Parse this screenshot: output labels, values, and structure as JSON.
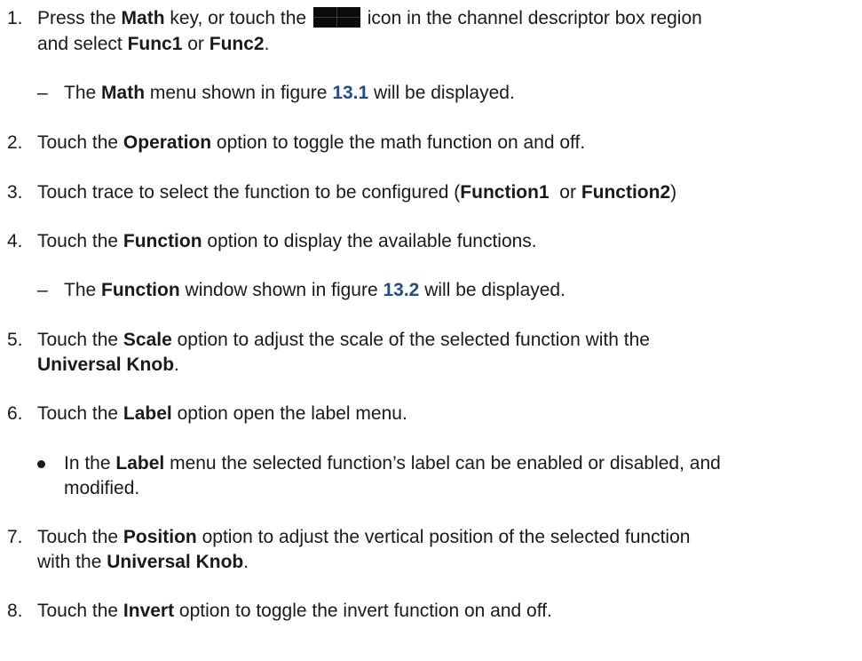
{
  "steps": [
    {
      "number": "1.",
      "line1": [
        "Press the ",
        "Math",
        " key, or touch the ",
        " icon in the channel descriptor box region"
      ],
      "line2": [
        "and select ",
        "Func1",
        " or ",
        "Func2",
        "."
      ],
      "sub": [
        "The ",
        "Math",
        " menu shown in figure ",
        "13.1",
        " will be displayed."
      ]
    },
    {
      "number": "2.",
      "line1": [
        "Touch the ",
        "Operation",
        " option to toggle the math function on and off."
      ]
    },
    {
      "number": "3.",
      "line1": [
        "Touch trace to select the function to be configured (",
        "Function1",
        "  or ",
        "Function2",
        ")"
      ]
    },
    {
      "number": "4.",
      "line1": [
        "Touch the ",
        "Function",
        " option to display the available functions."
      ],
      "sub": [
        "The ",
        "Function",
        " window shown in figure ",
        "13.2",
        " will be displayed."
      ]
    },
    {
      "number": "5.",
      "line1": [
        "Touch the ",
        "Scale",
        " option to adjust the scale of the selected function with the"
      ],
      "line2": [
        "Universal Knob",
        "."
      ]
    },
    {
      "number": "6.",
      "line1": [
        "Touch the ",
        "Label",
        " option open the label menu."
      ],
      "bullet_line1": [
        "In the ",
        "Label",
        " menu the selected function’s label can be enabled or disabled, and"
      ],
      "bullet_line2": "modified."
    },
    {
      "number": "7.",
      "line1": [
        "Touch the ",
        "Position",
        " option to adjust the vertical position of the selected function"
      ],
      "line2": [
        "with the ",
        "Universal Knob",
        "."
      ]
    },
    {
      "number": "8.",
      "line1": [
        "Touch the ",
        "Invert",
        " option to toggle the invert function on and off."
      ]
    }
  ],
  "dash_char": "–",
  "colors": {
    "text": "#1a1a1a",
    "figure_ref": "#1f4e8c",
    "icon_bg": "#0b0b0b"
  },
  "icons": {
    "channel_descriptor": "math-channel-icon"
  }
}
